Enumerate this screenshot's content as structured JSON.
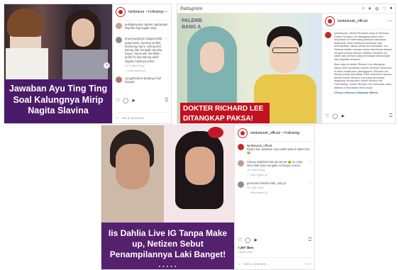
{
  "post1": {
    "username": "lambeturah_official",
    "follow_label": "• Following",
    "caption": "Jawaban Ayu Ting Ting Soal Kalungnya Mirip Nagita Slavina",
    "comments": [
      {
        "user": "pudiigasyuiye",
        "text": "pudiigasyuiye ngebet ngebanget kaylake tiap kagak mirip"
      },
      {
        "user": "ahyumandjoyer",
        "text": "ahyumandjoyer Nagita 500jt gaap bulan, ayuring sedikit kesarung hauni. Sering beli kalung dari menjadi mendup bayar, mana asli, sembilan puluh itu tiap kalung aduh Nagita mukanya pinter"
      },
      {
        "user": "cyngabsulmw",
        "text": "cyngabsulmw Bedanya hari banyak"
      }
    ],
    "meta": "2d 12 likes Reply",
    "view_replies": "— View replies (2)",
    "likes": "",
    "add_comment": "Add a comment..."
  },
  "post2": {
    "topbar_logo": "Instagram",
    "username": "lambeturah_official",
    "watermark": "PALEMB BANG A",
    "caption": "DOKTER RICHARD LEE DITANGKAP PAKSA!",
    "description": "lambeturah_official Penahan yang di Tahanan. Dokter Richard Lee ditangkap paksa oleh kepolisian di Palembang lantaran kasusnya dilaporkan telah membuat keributan dan menciptakan ujaran penipuan kesehatan. Ibu Rahmat selaku mantan cukup kebutuhan disana menjadi korban dirinya. Bahkan Richard Lee salah satu pemain yang mendapat keuntungan dari kegiatan tersebut.",
    "description2": "Baru saja ini dokter Richard Lee ditangkap paksa oleh kepolisian setelah beredar berita jika ia telah melakukan pelanggaran. Richard Lee dimana pihak kepolisian telah menerima laporan terkait Dokter Richard Lee yang kemudian langsung memproses dokter tersebut ke Palembang. Dokter Richard Lee kemudian akan ditahan di kepolisian lebih lanjut.",
    "tag": "#Tempo #Menurut #Kejadian #Berita",
    "add_comment": "Add a comment...",
    "post_btn": "Post"
  },
  "post3": {
    "username": "lambeturah_official",
    "follow_label": "• Following",
    "caption": "Iis Dahlia Live IG Tanpa Make up, Netizen Sebut Penampilannya Laki Banget!",
    "intro": "lambeturah_official",
    "intro_text": "Begini kan jawaban nya sudah ada di dalam bio 😂",
    "comments": [
      {
        "user": "rdnzaa",
        "text": "rdnzaa Hilahlah kalo dia bener 😂 ini mirip diria Wak Dara nungkin ini hanya cemen",
        "meta": "1h 2 likes Reply",
        "replies": "— View replies (1)"
      },
      {
        "user": "gemmara",
        "text": "gemmara hahaha laki, yang 9",
        "meta": "1h 1 like Reply",
        "replies": "— View replies (2)"
      }
    ],
    "likes": "7,397 likes",
    "date": "2 DAYS AGO",
    "add_comment": "Add a comment...",
    "post_btn": "Post"
  }
}
